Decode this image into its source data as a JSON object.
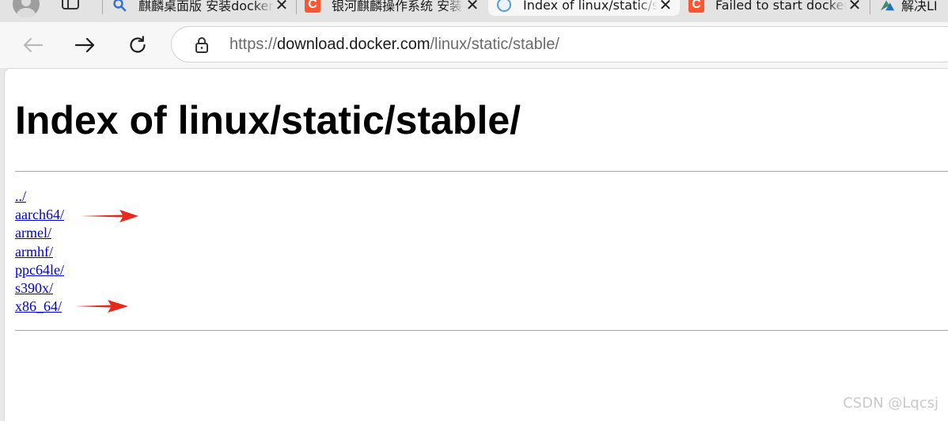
{
  "tabs": [
    {
      "title": "麒麟桌面版 安装docker",
      "favicon": "search-icon",
      "active": false
    },
    {
      "title": "银河麒麟操作系统 安装",
      "favicon": "csdn-icon",
      "active": false
    },
    {
      "title": "Index of linux/static/stable/",
      "favicon": "globe-icon",
      "active": true
    },
    {
      "title": "Failed to start docker",
      "favicon": "csdn-icon",
      "active": false
    },
    {
      "title": "解决LI",
      "favicon": "tab-icon",
      "active": false
    }
  ],
  "csdn_favicon_letter": "C",
  "toolbar": {
    "back": "back-arrow-icon",
    "forward": "forward-arrow-icon",
    "reload": "reload-icon"
  },
  "address": {
    "scheme": "https://",
    "host": "download.docker.com",
    "path": "/linux/static/stable/"
  },
  "page": {
    "heading": "Index of linux/static/stable/",
    "entries": [
      "../",
      "aarch64/",
      "armel/",
      "armhf/",
      "ppc64le/",
      "s390x/",
      "x86_64/"
    ],
    "arrow_marked_entries": [
      "aarch64/",
      "x86_64/"
    ]
  },
  "colors": {
    "link": "#0000cc",
    "annotation_arrow": "#e8271d",
    "csdn": "#fc5531"
  },
  "watermark": "CSDN @Lqcsj"
}
